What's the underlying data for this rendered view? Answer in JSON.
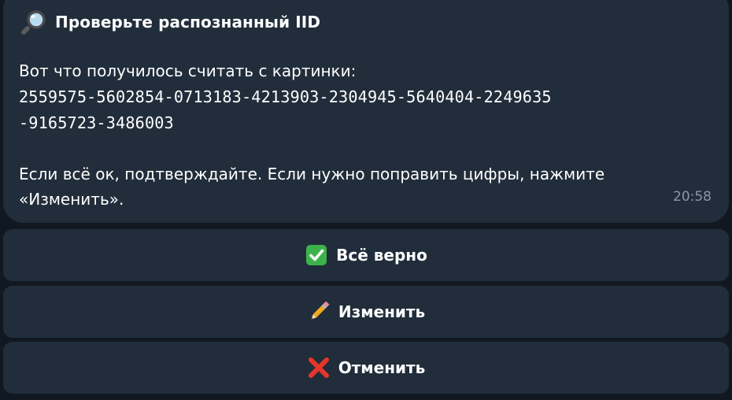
{
  "message": {
    "title_icon": "magnifier-icon",
    "title": "Проверьте распознанный IID",
    "intro": "Вот что получилось считать с картинки:",
    "iid_line1": "2559575-5602854-0713183-4213903-2304945-5640404-2249635",
    "iid_line2": "-9165723-3486003",
    "instruction_line1": "Если всё ок, подтверждайте. Если нужно поправить цифры, нажмите",
    "instruction_line2": "«Изменить».",
    "time": "20:58"
  },
  "buttons": [
    {
      "icon": "check-mark-icon",
      "label": "Всё верно",
      "icon_color": "#3cb34a"
    },
    {
      "icon": "pencil-icon",
      "label": "Изменить",
      "icon_color": "#f0a81c"
    },
    {
      "icon": "cross-mark-icon",
      "label": "Отменить",
      "icon_color": "#e6362c"
    }
  ],
  "colors": {
    "background": "#111821",
    "surface": "#212d3b",
    "text": "#ffffff",
    "timestamp": "#8a96a3"
  }
}
